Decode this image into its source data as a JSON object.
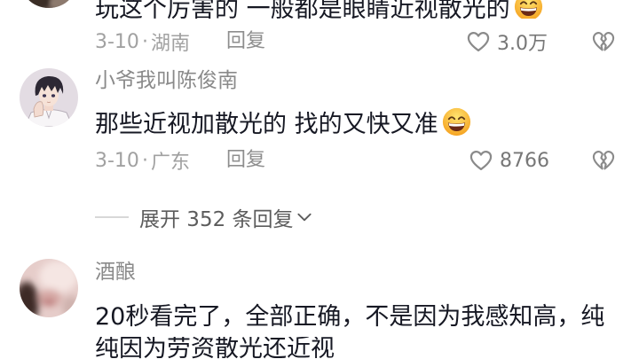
{
  "colors": {
    "background": "#ffffff",
    "text_primary": "#161823",
    "text_username": "#8a8a8a",
    "text_meta": "#a1a1a1",
    "text_reply": "#8e8e8e",
    "text_likes": "#777777",
    "text_expand": "#5c5c5c",
    "icon_gray": "#8a8a8a",
    "divider": "#d8d8d8",
    "emoji_yellow": "#ffdf5e",
    "emoji_orange": "#f5a11f"
  },
  "meta_separator": "·",
  "comments": [
    {
      "text": "玩这个厉害的 一般都是眼睛近视散光的",
      "emoji_icon": "grinning-face-with-smiling-eyes-icon",
      "date": "3-10",
      "location": "湖南",
      "reply_label": "回复",
      "like_icon": "heart-outline-icon",
      "likes": "3.0万",
      "dislike_icon": "broken-heart-icon"
    },
    {
      "username": "小爷我叫陈俊南",
      "text": "那些近视加散光的 找的又快又准",
      "emoji_icon": "grinning-face-with-smiling-eyes-icon",
      "date": "3-10",
      "location": "广东",
      "reply_label": "回复",
      "like_icon": "heart-outline-icon",
      "likes": "8766",
      "dislike_icon": "broken-heart-icon"
    },
    {
      "username": "酒酿",
      "lines": [
        "20秒看完了，全部正确，不是因为我感知高，纯",
        "纯因为劳资散光还近视"
      ]
    }
  ],
  "expand_replies": {
    "label": "展开 352 条回复",
    "icon": "chevron-down-icon"
  }
}
